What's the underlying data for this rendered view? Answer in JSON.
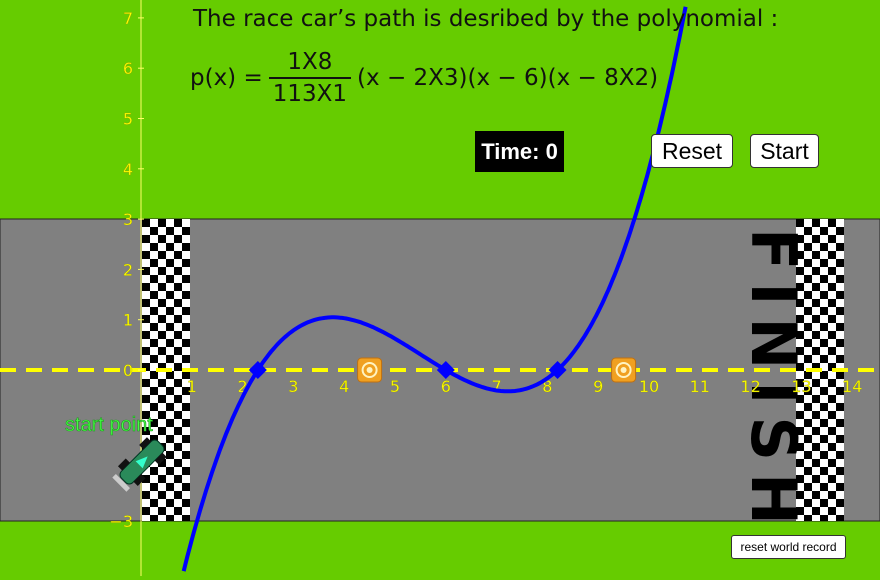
{
  "header": {
    "description": "The race car’s path is desribed by the polynomial :",
    "formula_prefix": "p(x) =",
    "frac_numerator": "1X8",
    "frac_denominator": "113X1",
    "formula_factors": "(x − 2X3)(x − 6)(x − 8X2)"
  },
  "timer": {
    "label": "Time: 0"
  },
  "buttons": {
    "reset": "Reset",
    "start": "Start",
    "reset_record": "reset world record"
  },
  "track": {
    "finish_text": "FINISH",
    "start_point_label": "start point"
  },
  "axes": {
    "x_ticks": [
      "1",
      "2",
      "3",
      "4",
      "5",
      "6",
      "7",
      "8",
      "9",
      "10",
      "11",
      "12",
      "13",
      "14"
    ],
    "y_ticks_above": [
      "7",
      "6",
      "5",
      "4",
      "3",
      "2",
      "1",
      "0"
    ],
    "y_ticks_below": [
      "−3"
    ]
  },
  "colors": {
    "grass": "#66cc00",
    "road": "#808080",
    "curve": "#0000ff",
    "dashed_line": "#ffff00",
    "axis_label": "#ffff00",
    "start_label": "#44ff44",
    "cone": "#f0a020"
  },
  "chart_data": {
    "type": "line",
    "function": "p(x) = a·(x − 2.3)(x − 6)(x − 8.2)",
    "roots": [
      2.3,
      6,
      8.2
    ],
    "xlim": [
      -2.8,
      14.6
    ],
    "ylim": [
      -4,
      7.3
    ],
    "targets": [
      4.5,
      9.5
    ]
  }
}
